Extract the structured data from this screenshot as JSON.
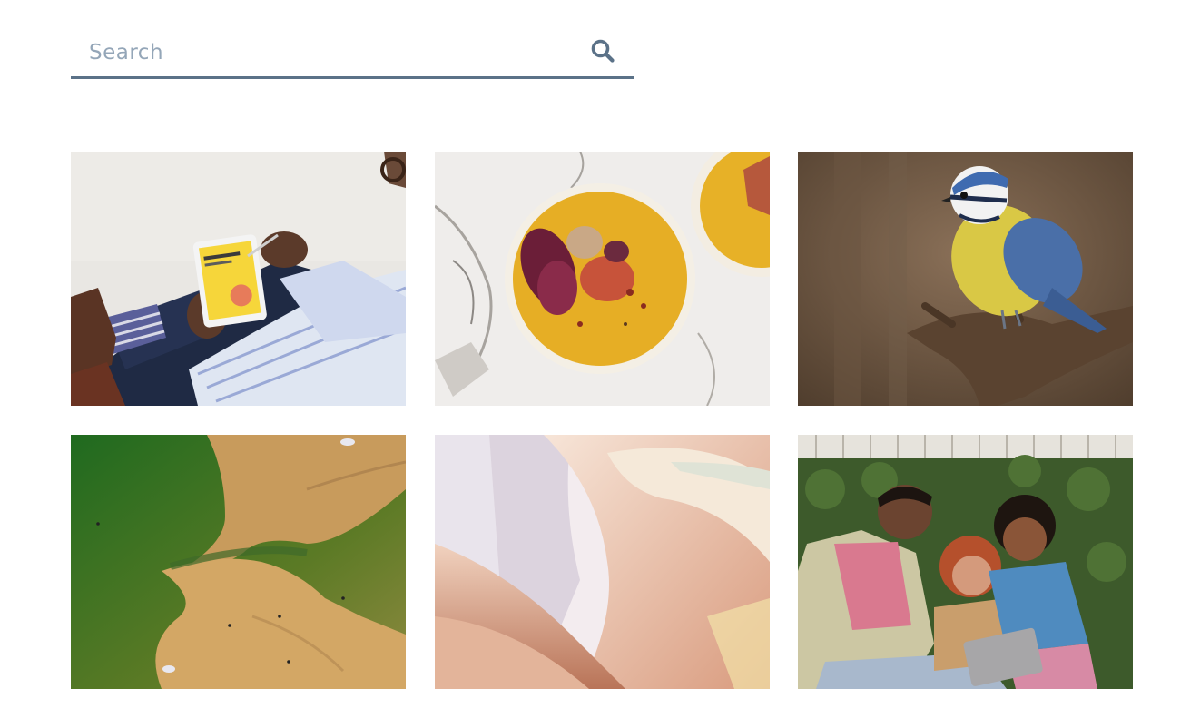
{
  "search": {
    "placeholder": "Search",
    "value": "",
    "icon": "search-icon"
  },
  "colors": {
    "search_underline": "#5b7288",
    "search_icon": "#5b7288",
    "placeholder": "#94a6b8"
  },
  "gallery": {
    "images": [
      {
        "subject": "person-using-tablet-photo"
      },
      {
        "subject": "soup-bowl-photo"
      },
      {
        "subject": "blue-tit-bird-photo"
      },
      {
        "subject": "aerial-beach-photo"
      },
      {
        "subject": "abstract-ribbon-photo"
      },
      {
        "subject": "friends-laughing-photo"
      }
    ]
  }
}
